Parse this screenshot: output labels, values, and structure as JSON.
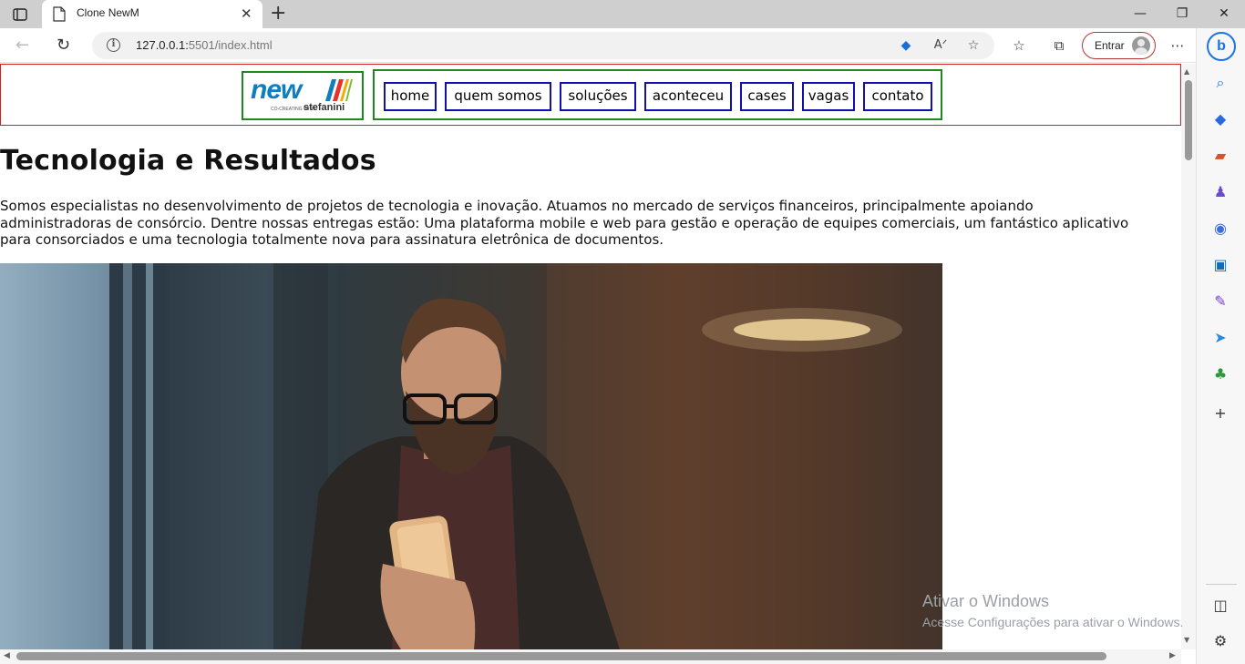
{
  "browser": {
    "tab_title": "Clone NewM",
    "url_host": "127.0.0.1:",
    "url_path": "5501/index.html",
    "signin_label": "Entrar"
  },
  "site": {
    "logo": {
      "word": "new",
      "tagline": "CO-CREATING WITH",
      "brand": "stefanini"
    },
    "nav": [
      "home",
      "quem somos",
      "soluções",
      "aconteceu",
      "cases",
      "vagas",
      "contato"
    ],
    "title": "Tecnologia e Resultados",
    "paragraph_lines": [
      "Somos especialistas no desenvolvimento de projetos de tecnologia e inovação. Atuamos no mercado de serviços financeiros, principalmente apoiando",
      "administradoras de consórcio. Dentre nossas entregas estão: Uma plataforma mobile e web para gestão e operação de equipes comerciais, um fantástico aplicativo",
      "para consorciados e uma tecnologia totalmente nova para assinatura eletrônica de documentos."
    ]
  },
  "watermark": {
    "line1": "Ativar o Windows",
    "line2": "Acesse Configurações para ativar o Windows."
  },
  "icons": {
    "titlebar": [
      "sidebar-toggle-icon",
      "favicon-icon",
      "close-icon",
      "plus-icon",
      "minimize-icon",
      "restore-icon",
      "window-close-icon"
    ],
    "toolbar": [
      "back-icon",
      "reload-icon",
      "info-icon",
      "tag-icon",
      "read-aloud-icon",
      "add-favorite-icon",
      "favorites-icon",
      "collections-icon",
      "more-icon"
    ],
    "sidebar": [
      "bing-icon",
      "search-icon",
      "shopping-icon",
      "tools-icon",
      "games-icon",
      "office-icon",
      "outlook-icon",
      "designer-icon",
      "send-icon",
      "tree-icon",
      "add-icon",
      "split-screen-icon",
      "settings-icon"
    ]
  },
  "colors": {
    "header_border": "#d62020",
    "box_border": "#1e8a1e",
    "nav_border": "#1010b0",
    "logo_blue": "#0d7fc0"
  }
}
